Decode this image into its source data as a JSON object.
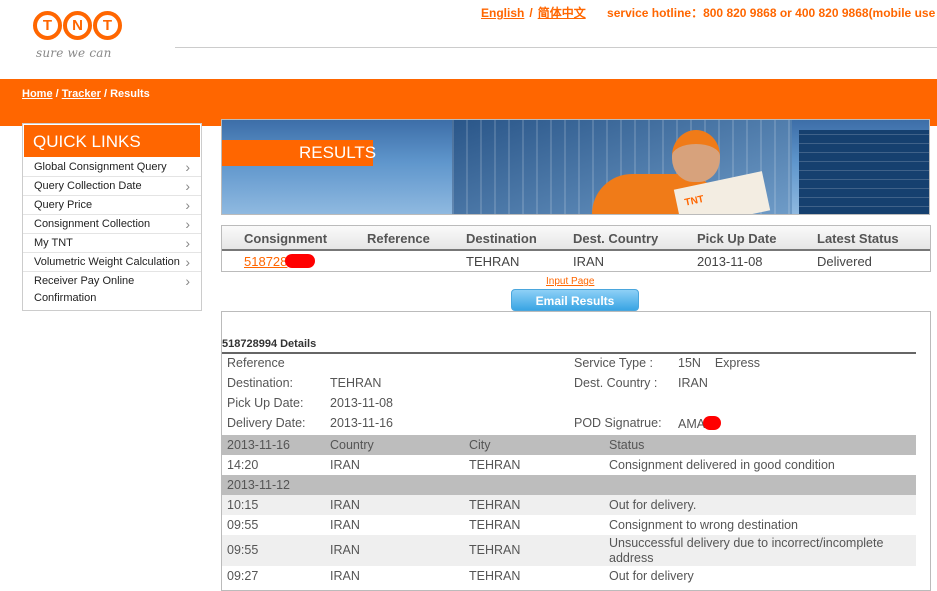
{
  "header": {
    "logo_letters": [
      "T",
      "N",
      "T"
    ],
    "logo_tagline": "sure we can",
    "lang_english": "English",
    "lang_chinese": "简体中文",
    "hotline": "service hotline：800 820 9868 or 400 820 9868(mobile use"
  },
  "breadcrumb": {
    "home": "Home",
    "tracker": "Tracker",
    "current": "Results"
  },
  "quick_links": {
    "title": "QUICK LINKS",
    "items": [
      "Global Consignment Query",
      "Query Collection Date",
      "Query Price",
      "Consignment Collection",
      "My TNT",
      "Volumetric Weight Calculation",
      "Receiver Pay Online",
      "Confirmation"
    ]
  },
  "banner": {
    "label": "RESULTS",
    "box_text": "TNT"
  },
  "results_table": {
    "headers": [
      "Consignment",
      "Reference",
      "Destination",
      "Dest. Country",
      "Pick Up Date",
      "Latest Status"
    ],
    "row": {
      "consignment": "518728",
      "reference": "",
      "destination": "TEHRAN",
      "dest_country": "IRAN",
      "pickup_date": "2013-11-08",
      "status": "Delivered"
    }
  },
  "actions": {
    "input_page": "Input Page",
    "email_results": "Email Results"
  },
  "details": {
    "title": "518728994  Details",
    "left": [
      {
        "label": "Reference",
        "value": ""
      },
      {
        "label": "Destination:",
        "value": "TEHRAN"
      },
      {
        "label": "Pick Up Date:",
        "value": "2013-11-08"
      },
      {
        "label": "Delivery Date:",
        "value": "2013-11-16"
      }
    ],
    "right": [
      {
        "label": "Service Type :",
        "value": "15N    Express"
      },
      {
        "label": "Dest. Country :",
        "value": "IRAN"
      },
      {
        "label": "POD Signatrue:",
        "value": "AMA"
      }
    ],
    "history": {
      "header": {
        "date": "2013-11-16",
        "country": "Country",
        "city": "City",
        "status": "Status"
      },
      "group1_events": [
        {
          "time": "14:20",
          "country": "IRAN",
          "city": "TEHRAN",
          "status": "Consignment delivered in good condition"
        }
      ],
      "group2_date": "2013-11-12",
      "group2_events": [
        {
          "time": "10:15",
          "country": "IRAN",
          "city": "TEHRAN",
          "status": "Out for delivery."
        },
        {
          "time": "09:55",
          "country": "IRAN",
          "city": "TEHRAN",
          "status": "Consignment to wrong destination"
        },
        {
          "time": "09:55",
          "country": "IRAN",
          "city": "TEHRAN",
          "status": "Unsuccessful delivery due to incorrect/incomplete address"
        },
        {
          "time": "09:27",
          "country": "IRAN",
          "city": "TEHRAN",
          "status": "Out for delivery"
        }
      ]
    }
  },
  "colors": {
    "brand_orange": "#ff6600",
    "redaction": "#ff0000",
    "button_blue": "#3aa5e4"
  }
}
